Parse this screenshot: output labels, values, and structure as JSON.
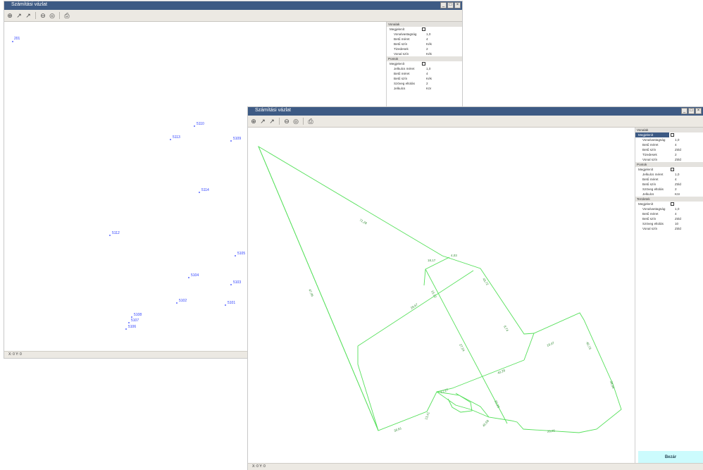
{
  "back_window": {
    "title": "Számítási vázlat",
    "title_buttons": [
      "_",
      "□",
      "×"
    ],
    "toolbar_icons": [
      "zoom-in-icon",
      "pan-icon",
      "pan-alt-icon",
      "zoom-window-icon",
      "zoom-extent-icon",
      "print-icon"
    ],
    "point_labels": [
      "201",
      "5110",
      "5113",
      "5109",
      "5114",
      "5112",
      "5105",
      "5104",
      "5103",
      "5102",
      "5101",
      "5108",
      "5107",
      "5106"
    ],
    "panel": [
      {
        "kind": "header",
        "label": "Vonalak"
      },
      {
        "kind": "sub",
        "label": "Megjelenít",
        "value": "checkbox"
      },
      {
        "kind": "row",
        "label": "Vonalvastagság",
        "value": "1,0"
      },
      {
        "kind": "row",
        "label": "Betű méret",
        "value": "4"
      },
      {
        "kind": "row",
        "label": "Betű szín",
        "value": "Kék"
      },
      {
        "kind": "row",
        "label": "Tizedesek",
        "value": "2"
      },
      {
        "kind": "row",
        "label": "Vonal szín",
        "value": "Kék"
      },
      {
        "kind": "header",
        "label": "Pontok"
      },
      {
        "kind": "sub",
        "label": "Megjelenít",
        "value": "checkbox"
      },
      {
        "kind": "row",
        "label": "Jelkulcs méret",
        "value": "1,0"
      },
      {
        "kind": "row",
        "label": "Betű méret",
        "value": "4"
      },
      {
        "kind": "row",
        "label": "Betű szín",
        "value": "Kék"
      },
      {
        "kind": "row",
        "label": "Szöveg eltolás",
        "value": "2"
      },
      {
        "kind": "row",
        "label": "Jelkulcs",
        "value": "Kör"
      }
    ],
    "status": "X: 0 Y: 0"
  },
  "front_window": {
    "title": "Számítási vázlat",
    "title_buttons": [
      "_",
      "□",
      "×"
    ],
    "toolbar_icons": [
      "zoom-in-icon",
      "pan-icon",
      "pan-alt-icon",
      "zoom-window-icon",
      "zoom-extent-icon",
      "print-icon"
    ],
    "panel": [
      {
        "kind": "header",
        "label": "Vonalak"
      },
      {
        "kind": "sub",
        "label": "Megjelenít",
        "value": "checkbox",
        "selected": true
      },
      {
        "kind": "row",
        "label": "Vonalvastagság",
        "value": "1,0"
      },
      {
        "kind": "row",
        "label": "Betű méret",
        "value": "4"
      },
      {
        "kind": "row",
        "label": "Betű szín",
        "value": "Zöld"
      },
      {
        "kind": "row",
        "label": "Tizedesek",
        "value": "2"
      },
      {
        "kind": "row",
        "label": "Vonal szín",
        "value": "Zöld"
      },
      {
        "kind": "header",
        "label": "Pontok"
      },
      {
        "kind": "sub",
        "label": "Megjelenít",
        "value": "checkbox"
      },
      {
        "kind": "row",
        "label": "Jelkulcs méret",
        "value": "1,0"
      },
      {
        "kind": "row",
        "label": "Betű méret",
        "value": "4"
      },
      {
        "kind": "row",
        "label": "Betű szín",
        "value": "Zöld"
      },
      {
        "kind": "row",
        "label": "Szöveg eltolás",
        "value": "2"
      },
      {
        "kind": "row",
        "label": "Jelkulcs",
        "value": "Kör"
      },
      {
        "kind": "header",
        "label": "Területek"
      },
      {
        "kind": "sub",
        "label": "Megjelenít",
        "value": "checkbox"
      },
      {
        "kind": "row",
        "label": "Vonalvastagság",
        "value": "1,0"
      },
      {
        "kind": "row",
        "label": "Betű méret",
        "value": "4"
      },
      {
        "kind": "row",
        "label": "Betű szín",
        "value": "Zöld"
      },
      {
        "kind": "row",
        "label": "Szöveg eltolás",
        "value": "10"
      },
      {
        "kind": "row",
        "label": "Vonal szín",
        "value": "Zöld"
      }
    ],
    "close_label": "Bezár",
    "status": "X: 0 Y: 0",
    "segment_labels": [
      "71,28",
      "47,46",
      "28,67",
      "4,03",
      "18,17",
      "45,72",
      "15,12",
      "8,74",
      "27,54",
      "19,47",
      "40,73",
      "40,28",
      "38,94",
      "17,27",
      "22,20",
      "13,41",
      "45,58",
      "36,61",
      "20,26"
    ]
  }
}
